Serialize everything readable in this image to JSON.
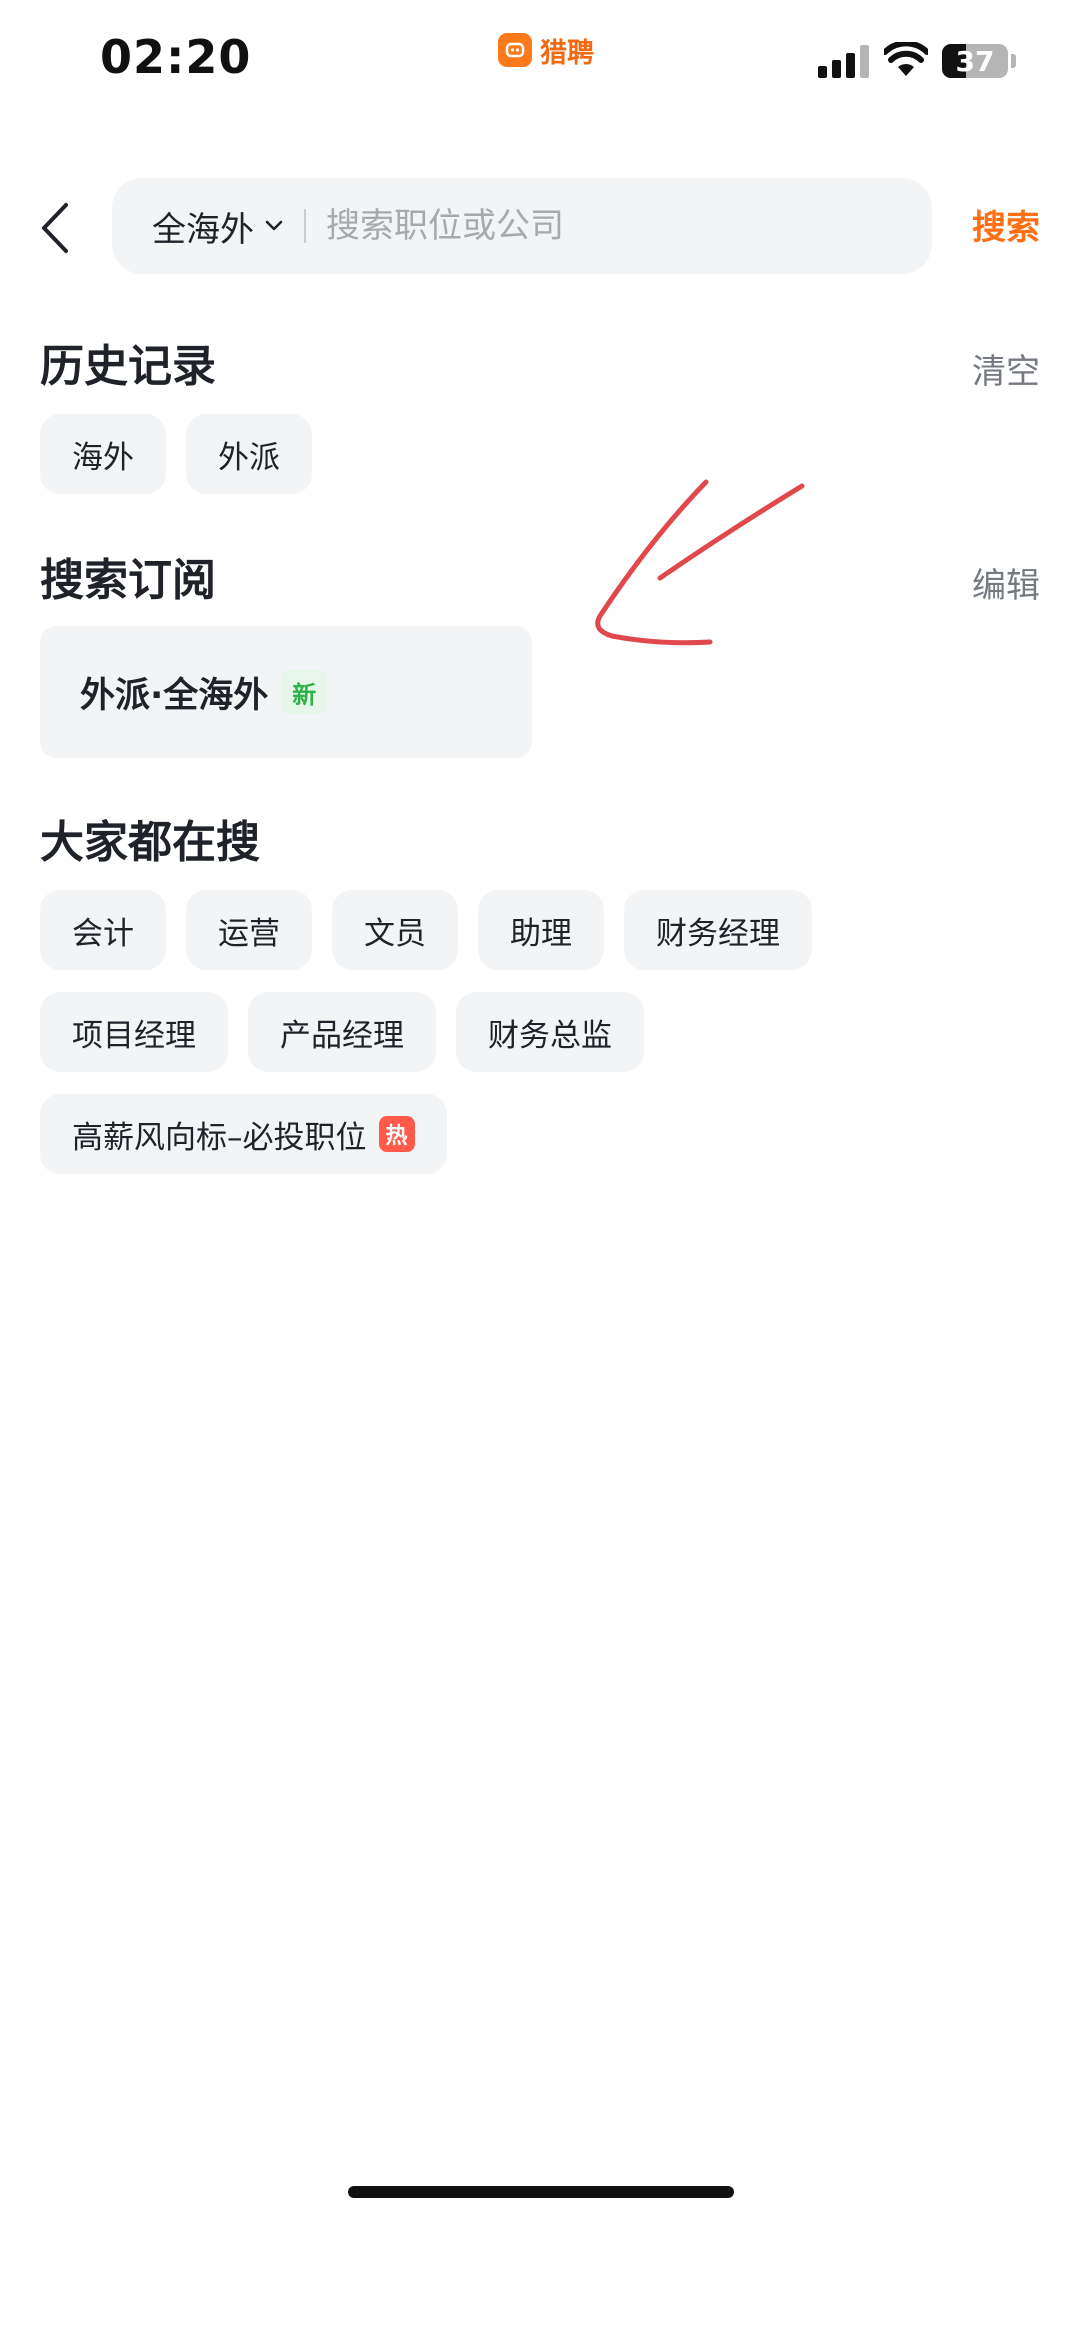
{
  "status_bar": {
    "time": "02:20",
    "app_name": "猎聘",
    "battery": "37",
    "battery_level": 0.37
  },
  "search": {
    "region": "全海外",
    "placeholder": "搜索职位或公司",
    "button_label": "搜索"
  },
  "history": {
    "title": "历史记录",
    "action": "清空",
    "items": [
      "海外",
      "外派"
    ]
  },
  "subscription": {
    "title": "搜索订阅",
    "action": "编辑",
    "item_label": "外派·全海外",
    "item_badge": "新"
  },
  "popular": {
    "title": "大家都在搜",
    "row1": [
      "会计",
      "运营",
      "文员",
      "助理",
      "财务经理"
    ],
    "row2": [
      "项目经理",
      "产品经理",
      "财务总监"
    ],
    "row3_label": "高薪风向标–必投职位",
    "row3_badge": "热"
  },
  "colors": {
    "accent": "#ff7014",
    "annotation": "#e0484c",
    "chip_bg": "#f3f4f6"
  }
}
